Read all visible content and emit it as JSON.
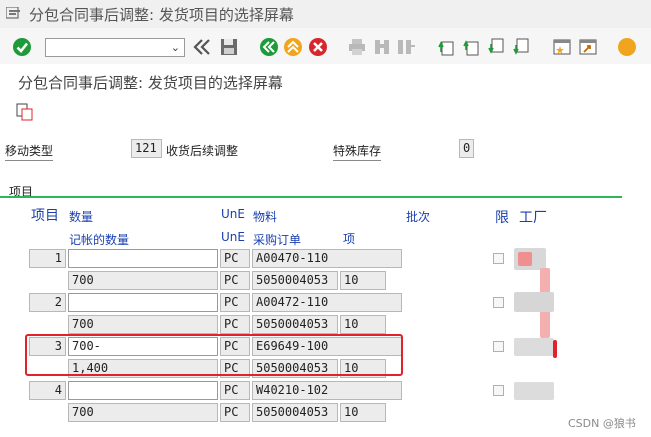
{
  "window": {
    "title": "分包合同事后调整: 发货项目的选择屏幕"
  },
  "toolbar": {
    "command_value": "",
    "icons": [
      "menu-icon",
      "enter-check-icon",
      "chevron-down-icon",
      "back-double-icon",
      "save-icon",
      "back-icon",
      "exit-up-icon",
      "cancel-icon",
      "print-icon",
      "find-icon",
      "find-next-icon",
      "first-page-icon",
      "previous-page-icon",
      "next-page-icon",
      "last-page-icon",
      "new-session-icon",
      "shortcut-icon",
      "help-icon"
    ],
    "colors": {
      "green": "#1e9a3a",
      "orange": "#f0a51e",
      "red": "#d7262c",
      "gray": "#b9b9b9"
    }
  },
  "screen": {
    "subtitle": "分包合同事后调整: 发货项目的选择屏幕",
    "copy_icon": "copy-document-icon"
  },
  "header": {
    "movement_type_label": "移动类型",
    "movement_type_value": "121",
    "movement_type_desc": "收货后续调整",
    "special_stock_label": "特殊库存",
    "special_stock_value": "0"
  },
  "items": {
    "section_title": "项目",
    "columns": {
      "item": "项目",
      "quantity": "数量",
      "unit": "UnE",
      "material": "物料",
      "batch": "批次",
      "limit": "限",
      "plant": "工厂",
      "posted_quantity": "记帐的数量",
      "unit2": "UnE",
      "po": "采购订单",
      "po_item": "项"
    },
    "rows": [
      {
        "item": "1",
        "quantity": "",
        "unit": "PC",
        "material": "A00470-110",
        "posted_quantity": "700",
        "unit2": "PC",
        "po": "5050004053",
        "po_item": "10"
      },
      {
        "item": "2",
        "quantity": "",
        "unit": "PC",
        "material": "A00472-110",
        "posted_quantity": "700",
        "unit2": "PC",
        "po": "5050004053",
        "po_item": "10"
      },
      {
        "item": "3",
        "quantity": "700-",
        "unit": "PC",
        "material": "E69649-100",
        "posted_quantity": "1,400",
        "unit2": "PC",
        "po": "5050004053",
        "po_item": "10"
      },
      {
        "item": "4",
        "quantity": "",
        "unit": "PC",
        "material": "W40210-102",
        "posted_quantity": "700",
        "unit2": "PC",
        "po": "5050004053",
        "po_item": "10"
      }
    ]
  },
  "footer": {
    "watermark": "CSDN @狼书"
  }
}
